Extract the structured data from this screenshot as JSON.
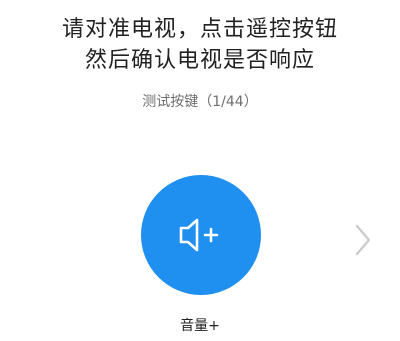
{
  "instruction": {
    "line1": "请对准电视，点击遥控按钮",
    "line2": "然后确认电视是否响应"
  },
  "progress_text": "测试按键（1/44）",
  "test_button": {
    "icon": "volume-up-icon",
    "label": "音量+",
    "color": "#1f8ff0"
  },
  "next_arrow": {
    "icon": "chevron-right-icon",
    "color": "#cccccc"
  }
}
